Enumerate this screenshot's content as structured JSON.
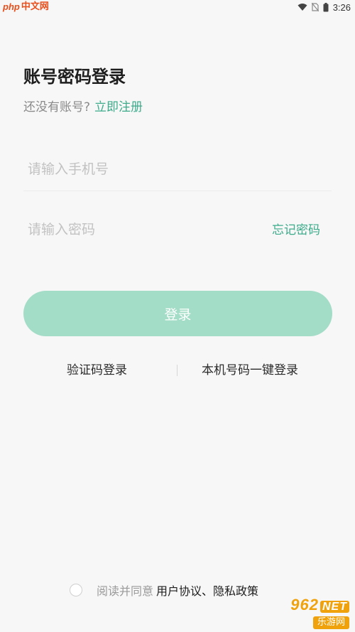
{
  "statusbar": {
    "watermark_php": "php",
    "watermark_cn": "中文网",
    "time": "3:26",
    "icons": [
      "wifi-icon",
      "no-sim-icon",
      "battery-icon"
    ]
  },
  "login": {
    "title": "账号密码登录",
    "no_account_text": "还没有账号?",
    "register_link": "立即注册",
    "phone_placeholder": "请输入手机号",
    "password_placeholder": "请输入密码",
    "forgot_password": "忘记密码",
    "login_button": "登录",
    "sms_login": "验证码登录",
    "one_click_login": "本机号码一键登录"
  },
  "agreement": {
    "prefix": "阅读并同意",
    "user_agreement": "用户协议",
    "separator": "、",
    "privacy_policy": "隐私政策"
  },
  "corner_logo": {
    "brand": "962",
    "net": "NET",
    "cn": "乐游网"
  },
  "colors": {
    "accent": "#3cab8a",
    "button_bg": "#a3dcc7",
    "background": "#f7f7f7"
  }
}
